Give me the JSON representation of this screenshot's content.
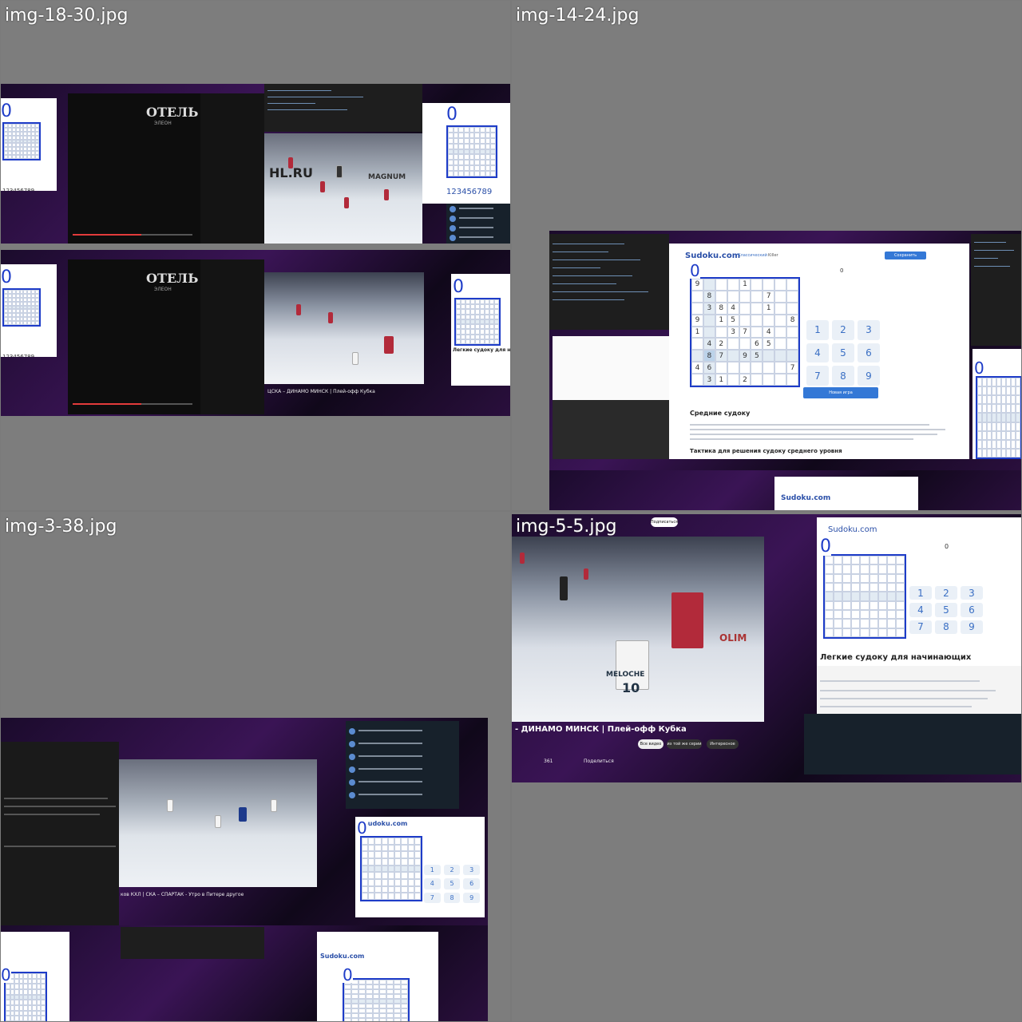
{
  "tiles": [
    {
      "filename": "img-18-30.jpg"
    },
    {
      "filename": "img-14-24.jpg"
    },
    {
      "filename": "img-3-38.jpg"
    },
    {
      "filename": "img-5-5.jpg"
    }
  ],
  "overlay_digit": "0",
  "video": {
    "otel_logo": "ОТЕЛЬ",
    "otel_sub": "ЭЛЕОН",
    "scoreboard_ad": "HL.RU",
    "ad_brand": "MAGNUM",
    "title_dinamo": "- ДИНАМО МИНСК | Плей-офф Кубка",
    "title_cska": "ЦСКА – ДИНАМО МИНСК | Плей-офф Кубка",
    "title_ska": "ков КХЛ | СКА – СПАРТАК - Утро в Питере другое",
    "subscribe": "Подписаться",
    "share": "Поделиться",
    "likes": "361",
    "chip_all": "Все видео",
    "chip_from": "из той же серии",
    "chip_related": "Интересное",
    "jersey_number": "10",
    "jersey_name": "MELOCHE",
    "arena_text": "OLIM"
  },
  "sudoku": {
    "site": "Sudoku.com",
    "nav_classic": "Классический",
    "nav_killer": "Killer",
    "premium_btn": "Сохранить",
    "score": "0",
    "new_game": "Новая игра",
    "heading_mid": "Средние судоку",
    "heading_mid_tactics": "Тактика для решения судоку среднего уровня",
    "heading_easy": "Легкие судоку для начинающих",
    "digits_line": "123456789",
    "digits_line2": "123456789",
    "numpad": [
      "1",
      "2",
      "3",
      "4",
      "5",
      "6",
      "7",
      "8",
      "9"
    ],
    "grid_large": [
      [
        "9",
        "",
        "",
        "",
        "1",
        "",
        "",
        "",
        ""
      ],
      [
        "",
        "8",
        "",
        "",
        "",
        "",
        "7",
        "",
        ""
      ],
      [
        "",
        "3",
        "8",
        "4",
        "",
        "",
        "1",
        "",
        ""
      ],
      [
        "9",
        "",
        "1",
        "5",
        "",
        "",
        "",
        "",
        "8"
      ],
      [
        "1",
        "",
        "",
        "3",
        "7",
        "",
        "4",
        "",
        ""
      ],
      [
        "",
        "4",
        "2",
        "",
        "",
        "6",
        "5",
        "",
        ""
      ],
      [
        "",
        "8",
        "7",
        "",
        "9",
        "5",
        "",
        "",
        ""
      ],
      [
        "4",
        "6",
        "",
        "",
        "",
        "",
        "",
        "",
        "7"
      ],
      [
        "",
        "3",
        "1",
        "",
        "2",
        "",
        "",
        "",
        ""
      ]
    ]
  }
}
